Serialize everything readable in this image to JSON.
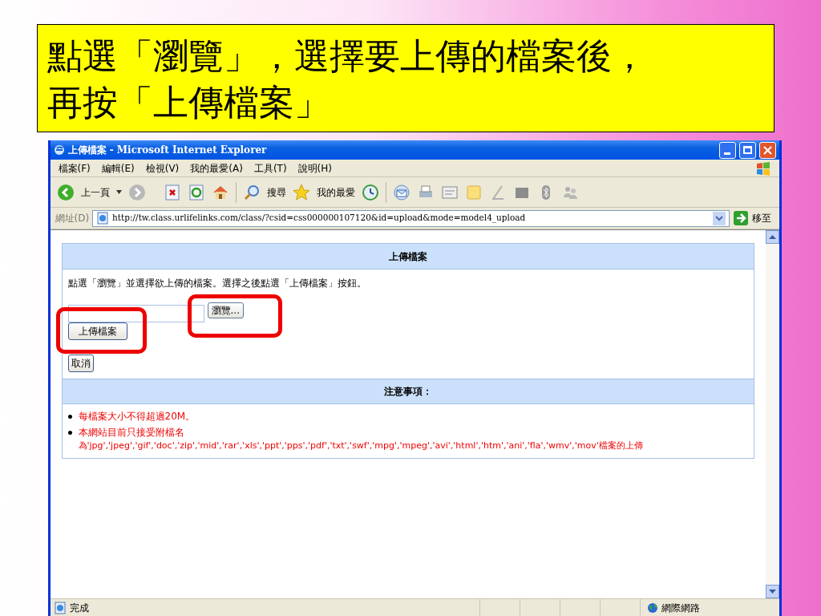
{
  "slide_title": {
    "lines": [
      "點選「瀏覽」，選擇要上傳的檔案後，",
      "再按「上傳檔案」"
    ]
  },
  "window": {
    "title": "上傳檔案 - Microsoft Internet Explorer"
  },
  "menu": [
    "檔案(F)",
    "編輯(E)",
    "檢視(V)",
    "我的最愛(A)",
    "工具(T)",
    "說明(H)"
  ],
  "toolbar": {
    "back": "上一頁",
    "search": "搜尋",
    "favorites": "我的最愛"
  },
  "address": {
    "label": "網址(D)",
    "url": "http://tw.class.urlifelinks.com/class/?csid=css000000107120&id=upload&mode=model4_upload",
    "go": "移至"
  },
  "upload_panel": {
    "header": "上傳檔案",
    "instruction": "點選「瀏覽」並選擇欲上傳的檔案。選擇之後點選「上傳檔案」按鈕。",
    "browse_button": "瀏覽...",
    "upload_button": "上傳檔案",
    "cancel_button": "取消"
  },
  "notes_panel": {
    "header": "注意事項：",
    "items": [
      {
        "text": "每檔案大小不得超過20M。"
      },
      {
        "text": "本網站目前只接受附檔名",
        "continuation": "為'jpg','jpeg','gif','doc','zip','mid','rar','xls','ppt','pps','pdf','txt','swf','mpg','mpeg','avi','html','htm','ani','fla','wmv','mov'檔案的上傳"
      }
    ]
  },
  "status_bar": {
    "status": "完成",
    "zone": "網際網路"
  }
}
